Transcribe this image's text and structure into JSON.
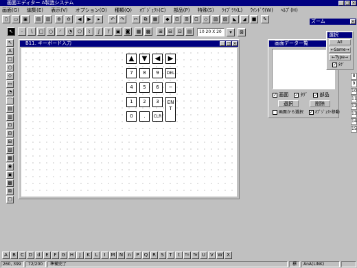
{
  "app": {
    "title": "画面エディター A製造システム"
  },
  "menu": [
    "画面(G)",
    "編集(E)",
    "表示(V)",
    "オプション(O)",
    "種類(Q)",
    "ｵﾌﾞｼﾞｪｸﾄ(C)",
    "部品(P)",
    "特殊(S)",
    "ﾗｲﾌﾞﾗﾘ(L)",
    "ｳｲﾝﾄﾞｳ(W)",
    "ﾍﾙﾌﾟ(H)"
  ],
  "toolbar2": {
    "grid_value": "10 20 X 20"
  },
  "zoom_panel": {
    "title": "ズーム"
  },
  "canvas_window": {
    "title": "B11. キーボード入力"
  },
  "keypad": {
    "arrows": [
      "▲",
      "▼",
      "◀",
      "▶"
    ],
    "row1": [
      "7",
      "8",
      "9",
      "DEL"
    ],
    "row2": [
      "4",
      "5",
      "6",
      "−"
    ],
    "row3": [
      "1",
      "2",
      "3"
    ],
    "row4": [
      "0",
      ".",
      "CLR"
    ],
    "enter": "ENT"
  },
  "data_list_window": {
    "title": "画面データ一覧",
    "chk_screen": "画面",
    "chk_tag": "ﾀｸﾞ",
    "chk_part": "部品",
    "btn_left": "選択",
    "btn_right": "削除",
    "chk_from_screen": "画面から選択",
    "chk_object_move": "ｵﾌﾞｼﾞｪｸﾄ移動"
  },
  "select_panel": {
    "title": "選択",
    "all": "All",
    "same": "Same",
    "type": "Type",
    "tag": "ﾀｸﾞ"
  },
  "row_numbers": [
    "8",
    "9",
    "10",
    "11",
    "12",
    "13",
    "14",
    "15"
  ],
  "left_tools": [
    "↖",
    "A",
    "□",
    "○",
    "◇",
    "▭",
    "◔",
    "⌒",
    "▤",
    "▥",
    "⊡",
    "⊟",
    "⊞",
    "▧",
    "▦",
    "◉",
    "▣",
    "▩",
    "⊠",
    "▢"
  ],
  "alpha_bar": [
    "A",
    "B",
    "C",
    "D",
    "d",
    "E",
    "F",
    "G",
    "H",
    "J",
    "K",
    "L",
    "I",
    "M",
    "N",
    "n",
    "P",
    "Q",
    "R",
    "S",
    "T",
    "t",
    "Tn",
    "Tw",
    "U",
    "V",
    "W",
    "X"
  ],
  "status": {
    "coords": "260, 399",
    "value": "72/200",
    "message": "準備完了",
    "mode": "標",
    "right": "AnA(LINK)"
  }
}
